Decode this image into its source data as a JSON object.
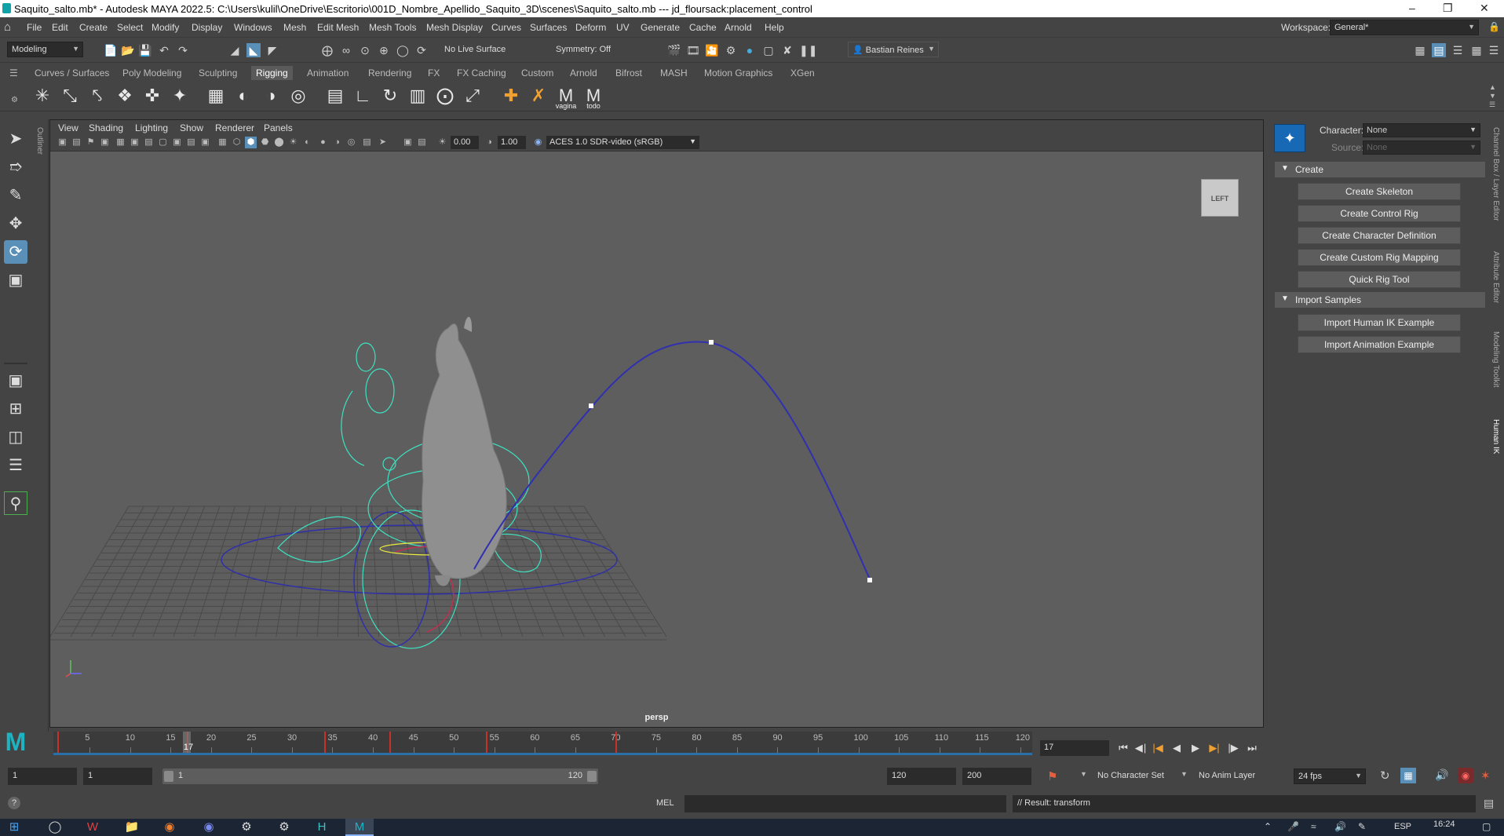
{
  "window": {
    "title": "Saquito_salto.mb* - Autodesk MAYA 2022.5: C:\\Users\\kulil\\OneDrive\\Escritorio\\001D_Nombre_Apellido_Saquito_3D\\scenes\\Saquito_salto.mb   ---   jd_floursack:placement_control",
    "minimize": "–",
    "restore": "❐",
    "close": "✕"
  },
  "menubar": {
    "items": [
      "File",
      "Edit",
      "Create",
      "Select",
      "Modify",
      "Display",
      "Windows",
      "Mesh",
      "Edit Mesh",
      "Mesh Tools",
      "Mesh Display",
      "Curves",
      "Surfaces",
      "Deform",
      "UV",
      "Generate",
      "Cache",
      "Arnold",
      "Help"
    ],
    "workspace_label": "Workspace:",
    "workspace_value": "General*"
  },
  "statusline": {
    "menuset": "Modeling",
    "live_surface": "No Live Surface",
    "symmetry": "Symmetry: Off",
    "user": "Bastian Reines"
  },
  "shelf": {
    "tabs": [
      "Curves / Surfaces",
      "Poly Modeling",
      "Sculpting",
      "Rigging",
      "Animation",
      "Rendering",
      "FX",
      "FX Caching",
      "Custom",
      "Arnold",
      "Bifrost",
      "MASH",
      "Motion Graphics",
      "XGen"
    ],
    "active_tab": "Rigging",
    "custom_icons": [
      "vagina",
      "todo"
    ]
  },
  "viewport": {
    "menus": [
      "View",
      "Shading",
      "Lighting",
      "Show",
      "Renderer",
      "Panels"
    ],
    "exposure": "0.00",
    "gamma": "1.00",
    "colorspace": "ACES 1.0 SDR-video (sRGB)",
    "viewcube_label": "LEFT",
    "camera": "persp"
  },
  "outliner": {
    "label": "Outliner"
  },
  "humanik": {
    "character_label": "Character:",
    "character_value": "None",
    "source_label": "Source:",
    "source_value": "None",
    "sections": [
      {
        "title": "Create",
        "buttons": [
          "Create Skeleton",
          "Create Control Rig",
          "Create Character Definition",
          "Create Custom Rig Mapping",
          "Quick Rig Tool"
        ]
      },
      {
        "title": "Import Samples",
        "buttons": [
          "Import Human IK Example",
          "Import Animation Example"
        ]
      }
    ]
  },
  "right_tabs": [
    "Channel Box / Layer Editor",
    "Attribute Editor",
    "Modeling Toolkit",
    "Human IK"
  ],
  "timeline": {
    "ticks": [
      5,
      10,
      15,
      20,
      25,
      30,
      35,
      40,
      45,
      50,
      55,
      60,
      65,
      70,
      75,
      80,
      85,
      90,
      95,
      100,
      105,
      110,
      115,
      120
    ],
    "current_frame": "17",
    "current_field": "17"
  },
  "range": {
    "start": "1",
    "playback_start": "1",
    "slider_start": "1",
    "slider_end": "120",
    "playback_end": "120",
    "end": "200",
    "character_set": "No Character Set",
    "anim_layer": "No Anim Layer",
    "fps": "24 fps"
  },
  "commandline": {
    "help": "?",
    "lang": "MEL",
    "result": "// Result: transform"
  },
  "taskbar": {
    "lang": "ESP",
    "time": "16:24"
  }
}
